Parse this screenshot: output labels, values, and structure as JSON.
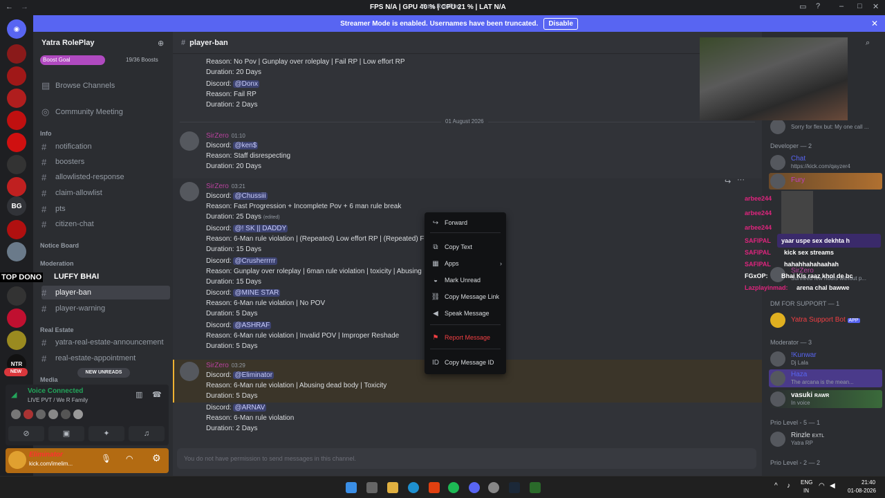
{
  "titlebar": {
    "perf": "FPS N/A | GPU 40 % | CPU 21 % | LAT N/A",
    "stream_title": "Yatra RolePlay"
  },
  "banner": {
    "text": "Streamer Mode is enabled. Usernames have been truncated.",
    "button": "Disable"
  },
  "server": {
    "name": "Yatra RolePlay",
    "boost_goal": "Boost Goal",
    "boosts": "19/36 Boosts"
  },
  "rail": {
    "bg_label": "BG",
    "new_badge": "NEW",
    "ntr_label": "NTR"
  },
  "sidebar": {
    "browse": "Browse Channels",
    "community": "Community Meeting",
    "info_cat": "Info",
    "channels": [
      "notification",
      "boosters",
      "allowlisted-response",
      "claim-allowlist",
      "pts",
      "citizen-chat"
    ],
    "notice_cat": "Notice Board",
    "moderation_cat": "Moderation",
    "overlay_donor": "TOP DONO",
    "overlay_name": "LUFFY BHAI",
    "mod_channels": [
      "player-ban",
      "player-warning"
    ],
    "realestate_cat": "Real Estate",
    "re_channels": [
      "yatra-real-estate-announcement",
      "real-estate-appointment"
    ],
    "media_cat": "Media",
    "new_unreads": "NEW UNREADS"
  },
  "voice": {
    "status": "Voice Connected",
    "channel": "LIVE PVT / We R Family"
  },
  "user": {
    "name": "Eliminator",
    "status": "kick.com/imelim..."
  },
  "channel": {
    "name": "player-ban",
    "input_placeholder": "You do not have permission to send messages in this channel."
  },
  "messages": {
    "m0": {
      "r1": "Reason: No Pov | Gunplay over roleplay | Fail RP | Low effort RP",
      "d1": "Duration: 20 Days",
      "discord": "Discord:",
      "u2": "@Donx",
      "r2": "Reason: Fail RP",
      "d2": "Duration: 2 Days"
    },
    "divider": "01 August 2026",
    "m1": {
      "author": "SirZero",
      "time": "01:10",
      "user": "@ken$",
      "reason": "Reason: Staff disrespecting",
      "dur": "Duration: 20 Days"
    },
    "m2": {
      "author": "SirZero",
      "time": "03:21",
      "edited": "(edited)",
      "entries": [
        {
          "user": "@Chussiii",
          "reason": "Reason: Fast Progression + Incomplete Pov + 6 man rule break",
          "dur": "Duration: 25 Days"
        },
        {
          "user": "@! SK || DADDY",
          "reason": "Reason: 6-Man rule violation | (Repeated) Low effort RP | (Repeated) F",
          "dur": "Duration: 15 Days"
        },
        {
          "user": "@Crusherrrrr",
          "reason": "Reason: Gunplay over roleplay | 6man rule violation | toxicity | Abusing",
          "dur": "Duration: 15 Days"
        },
        {
          "user": "@MINE STAR",
          "reason": "Reason: 6-Man rule violation | No POV",
          "dur": "Duration: 5 Days"
        },
        {
          "user": "@ASHRAF",
          "reason": "Reason: 6-Man rule violation | Invalid POV | Improper Reshade",
          "dur": "Duration: 5 Days"
        }
      ]
    },
    "m3": {
      "author": "SirZero",
      "time": "03:29",
      "entries": [
        {
          "user": "@Eliminator",
          "reason": "Reason: 6-Man rule violation | Abusing dead body | Toxicity",
          "dur": "Duration: 5 Days"
        },
        {
          "user": "@ARNAV",
          "reason": "Reason: 6-Man rule violation",
          "dur": "Duration: 2 Days"
        }
      ]
    }
  },
  "context_menu": [
    "Forward",
    "Copy Text",
    "Apps",
    "Mark Unread",
    "Copy Message Link",
    "Speak Message",
    "Report Message",
    "Copy Message ID"
  ],
  "members": {
    "top_status": "Sorry for flex but: My one call ...",
    "dev_head": "Developer — 2",
    "dev1_name": "Chat",
    "dev1_status": "https://kick.com/qayzer4",
    "dev2_name": "Fury",
    "dm_head": "DM FOR SUPPORT — 1",
    "bot_name": "Yatra Support Bot",
    "bot_tag": "APP",
    "mod_head": "Moderator — 3",
    "mod1_name": "!Kunwar",
    "mod1_status": "Dj Lala",
    "mod2_name": "Haza",
    "mod2_status": "The arcana is the mean...",
    "mod3_name": "vasuki",
    "mod3_tag": "RAWR",
    "mod3_status": "In voice",
    "prio5_head": "Prio Level - 5 — 1",
    "prio5_name": "Rinzle",
    "prio5_tag": "EXTL",
    "prio5_status": "Yatra RP",
    "prio2_head": "Prio Level - 2 — 2",
    "sirzero": "SirZero",
    "sirzero_status": "Survived few hours without p..."
  },
  "stream_chat": [
    {
      "user": "arbee244",
      "msg": ""
    },
    {
      "user": "arbee244",
      "msg": ""
    },
    {
      "user": "arbee244",
      "msg": ""
    },
    {
      "user": "SAFIPAL",
      "msg": "yaar uspe sex dekhta h"
    },
    {
      "user": "SAFIPAL",
      "msg": "kick sex streams"
    },
    {
      "user": "SAFIPAL",
      "msg": "hahahhahahaahah"
    },
    {
      "user": "FGxOP:",
      "msg": "Bhai Kis raaz khol de bc"
    },
    {
      "user": "Lazplayinmad:",
      "msg": "arena chal bawwe"
    }
  ],
  "tray": {
    "lang": "ENG",
    "region": "IN",
    "time": "21:40",
    "date": "01-08-2026"
  }
}
